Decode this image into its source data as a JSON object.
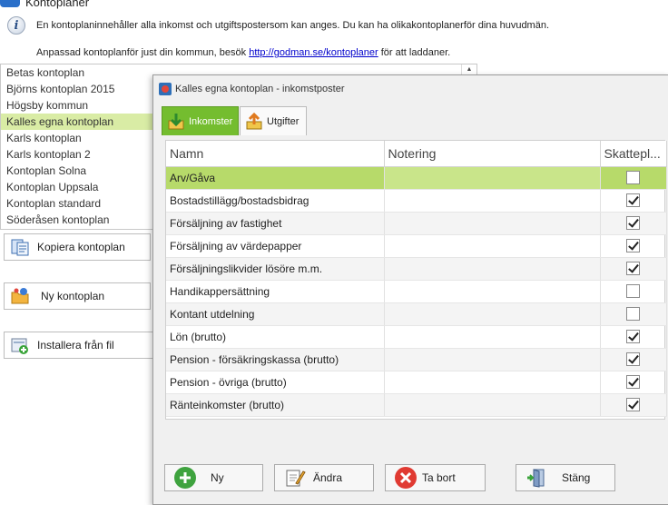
{
  "app": {
    "title": "Kontoplaner"
  },
  "info": {
    "line1": "En kontoplaninnehåller alla inkomst och utgiftspostersom kan anges. Du kan ha olikakontoplanerför dina huvudmän.",
    "line2_before": "Anpassad kontoplanför just din kommun, besök ",
    "line2_link": "http://godman.se/kontoplaner",
    "line2_after": " för att laddaner."
  },
  "plans": [
    "Betas kontoplan",
    "Björns kontoplan 2015",
    "Högsby kommun",
    "Kalles egna kontoplan",
    "Karls kontoplan",
    "Karls kontoplan 2",
    "Kontoplan Solna",
    "Kontoplan Uppsala",
    "Kontoplan standard",
    "Söderåsen kontoplan"
  ],
  "selected_plan_index": 3,
  "side_buttons": {
    "copy": "Kopiera kontoplan",
    "new": "Ny kontoplan",
    "install": "Installera från fil"
  },
  "dialog": {
    "title": "Kalles egna kontoplan - inkomstposter",
    "tabs": {
      "income": "Inkomster",
      "expenses": "Utgifter"
    },
    "columns": {
      "name": "Namn",
      "note": "Notering",
      "tax": "Skattepl..."
    },
    "rows": [
      {
        "name": "Arv/Gåva",
        "note": "",
        "taxable": false
      },
      {
        "name": "Bostadstillägg/bostadsbidrag",
        "note": "",
        "taxable": true
      },
      {
        "name": "Försäljning av fastighet",
        "note": "",
        "taxable": true
      },
      {
        "name": "Försäljning av värdepapper",
        "note": "",
        "taxable": true
      },
      {
        "name": "Försäljningslikvider lösöre m.m.",
        "note": "",
        "taxable": true
      },
      {
        "name": "Handikappersättning",
        "note": "",
        "taxable": false
      },
      {
        "name": "Kontant utdelning",
        "note": "",
        "taxable": false
      },
      {
        "name": "Lön (brutto)",
        "note": "",
        "taxable": true
      },
      {
        "name": "Pension - försäkringskassa (brutto)",
        "note": "",
        "taxable": true
      },
      {
        "name": "Pension - övriga (brutto)",
        "note": "",
        "taxable": true
      },
      {
        "name": "Ränteinkomster (brutto)",
        "note": "",
        "taxable": true
      }
    ],
    "buttons": {
      "new": "Ny",
      "edit": "Ändra",
      "delete": "Ta bort",
      "close": "Stäng"
    }
  },
  "colors": {
    "accent_green": "#74bd2f",
    "selected_row": "#b7da6a",
    "list_selection": "#d9eca5",
    "link": "#0000cc"
  }
}
